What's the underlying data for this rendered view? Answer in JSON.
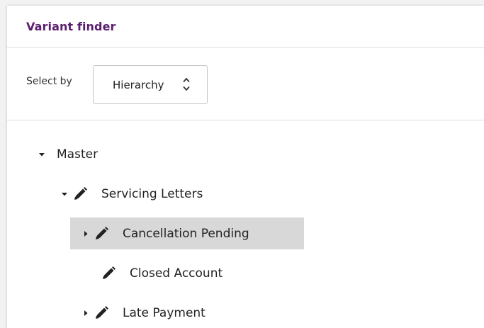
{
  "header": {
    "title": "Variant finder"
  },
  "select_by": {
    "label": "Select by",
    "value": "Hierarchy"
  },
  "tree": {
    "master": {
      "label": "Master",
      "expanded": true
    },
    "servicing_letters": {
      "label": "Servicing Letters",
      "expanded": true
    },
    "cancellation_pending": {
      "label": "Cancellation Pending",
      "expanded": false,
      "selected": true
    },
    "closed_account": {
      "label": "Closed Account"
    },
    "late_payment": {
      "label": "Late Payment",
      "expanded": false
    }
  },
  "colors": {
    "title": "#5b1e6e",
    "selected_row": "#d8d8d8",
    "border": "#dcdcdc"
  }
}
